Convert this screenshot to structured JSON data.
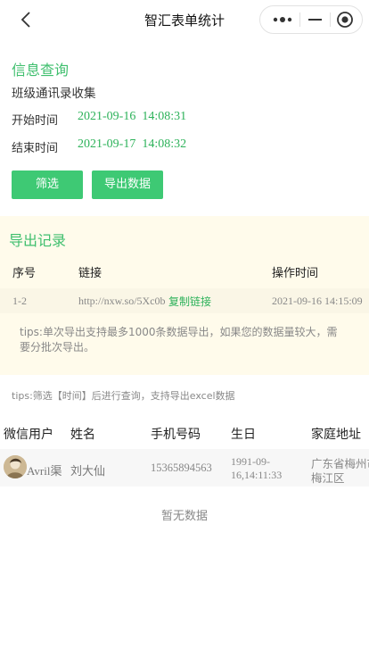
{
  "nav": {
    "title": "智汇表单统计"
  },
  "info": {
    "section_title": "信息查询",
    "form_name": "班级通讯录收集",
    "start_label": "开始时间",
    "start_date": "2021-09-16",
    "start_time": "14:08:31",
    "end_label": "结束时间",
    "end_date": "2021-09-17",
    "end_time": "14:08:32",
    "filter_button": "筛选",
    "export_button": "导出数据"
  },
  "export_record": {
    "section_title": "导出记录",
    "headers": {
      "index": "序号",
      "link": "链接",
      "time": "操作时间"
    },
    "rows": [
      {
        "index": "1-2",
        "url": "http://nxw.so/5Xc0b",
        "copy_label": "复制链接",
        "time": "2021-09-16 14:15:09"
      }
    ],
    "tips": "tips:单次导出支持最多1000条数据导出，如果您的数据量较大，需要分批次导出。"
  },
  "filter_tips": "tips:筛选【时间】后进行查询，支持导出excel数据",
  "data_table": {
    "headers": {
      "wechat_user": "微信用户",
      "name": "姓名",
      "phone": "手机号码",
      "birthday": "生日",
      "address": "家庭地址"
    },
    "rows": [
      {
        "wechat_user": "Avril渠",
        "name": "刘大仙",
        "phone": "15365894563",
        "birthday_line1": "1991-09-",
        "birthday_line2": "16,14:11:33",
        "address_line1": "广东省梅州市",
        "address_line2": "梅江区"
      }
    ],
    "empty_text": "暂无数据"
  },
  "colors": {
    "accent_green": "#3fbf6e",
    "button_green": "#3ec974",
    "export_bg": "#fffbeb"
  }
}
